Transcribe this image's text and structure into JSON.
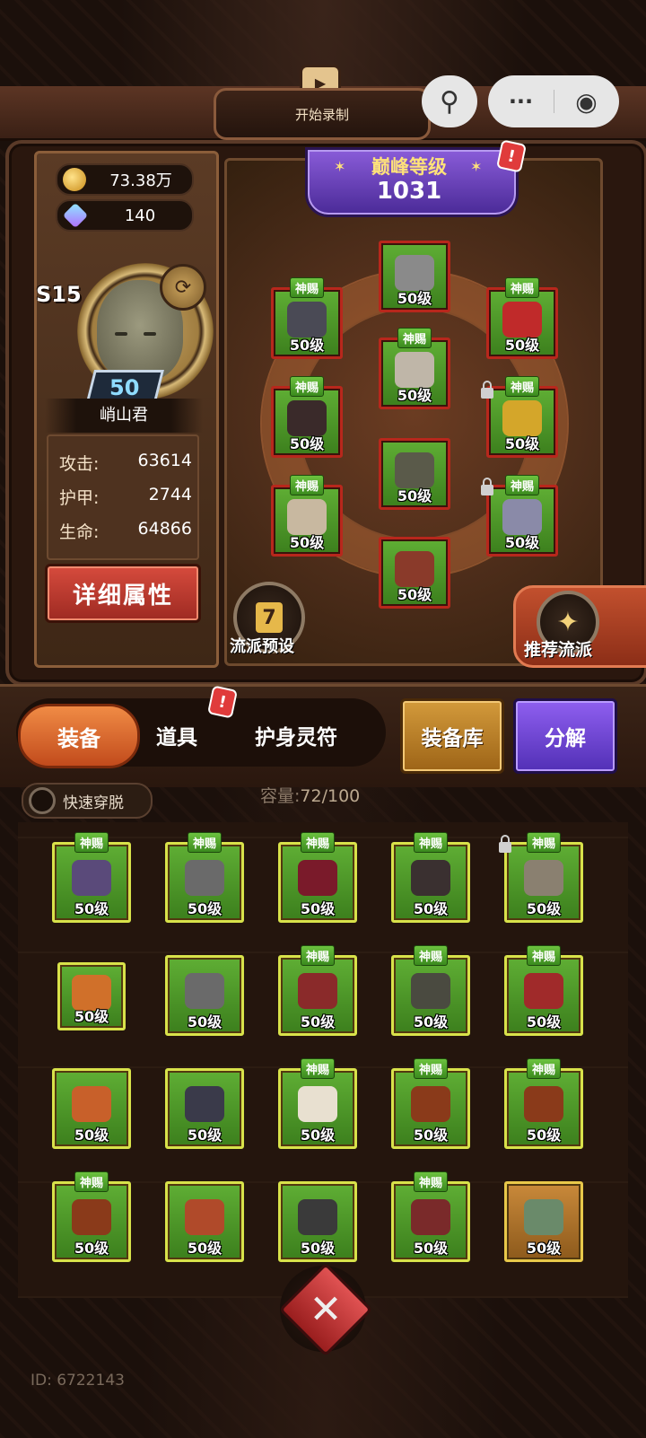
{
  "topbar": {
    "record_label": "开始录制",
    "menu_dots": "···",
    "record_dot": "◉",
    "avatar_glyph": "⚲"
  },
  "currency": {
    "gold": "73.38万",
    "gems": "140"
  },
  "player": {
    "season": "S15",
    "level": "50",
    "name": "峭山君",
    "stats": [
      {
        "label": "攻击:",
        "value": "63614"
      },
      {
        "label": "护甲:",
        "value": "2744"
      },
      {
        "label": "生命:",
        "value": "64866"
      }
    ],
    "detail_button": "详细属性"
  },
  "peak": {
    "title": "巅峰等级",
    "value": "1031"
  },
  "alert_mark": "!",
  "equipped": [
    {
      "tag": "",
      "level": "50级",
      "color": "#8a8a8a"
    },
    {
      "tag": "神赐",
      "level": "50级",
      "color": "#4a4a55"
    },
    {
      "tag": "神赐",
      "level": "50级",
      "color": "#c02a2a"
    },
    {
      "tag": "神赐",
      "level": "50级",
      "color": "#bfb6a8"
    },
    {
      "tag": "神赐",
      "level": "50级",
      "color": "#3a2a2a"
    },
    {
      "tag": "神赐",
      "level": "50级",
      "color": "#d4a62a"
    },
    {
      "tag": "",
      "level": "50级",
      "color": "#5a5a4a"
    },
    {
      "tag": "神赐",
      "level": "50级",
      "color": "#c8b8a0"
    },
    {
      "tag": "神赐",
      "level": "50级",
      "color": "#8a8aa8"
    },
    {
      "tag": "",
      "level": "50级",
      "color": "#8a3a2a"
    }
  ],
  "preset_label": "流派预设",
  "preset_icon": "7",
  "recommend_label": "推荐流派",
  "tabs": {
    "equipment": "装备",
    "items": "道具",
    "talisman": "护身灵符"
  },
  "actions": {
    "warehouse": "装备库",
    "decompose": "分解"
  },
  "quick_toggle": "快速穿脱",
  "capacity": {
    "label": "容量:",
    "value": "72/100"
  },
  "inventory": [
    {
      "tag": "神赐",
      "level": "50级",
      "color": "#5a4a7a"
    },
    {
      "tag": "神赐",
      "level": "50级",
      "color": "#6a6a6a"
    },
    {
      "tag": "神赐",
      "level": "50级",
      "color": "#7a1a2a"
    },
    {
      "tag": "神赐",
      "level": "50级",
      "color": "#3a3030"
    },
    {
      "tag": "神赐",
      "level": "50级",
      "color": "#8a8070"
    },
    {
      "tag": "",
      "level": "50级",
      "color": "#d0702a"
    },
    {
      "tag": "",
      "level": "50级",
      "color": "#6a6a6a"
    },
    {
      "tag": "神赐",
      "level": "50级",
      "color": "#8a2a2a"
    },
    {
      "tag": "神赐",
      "level": "50级",
      "color": "#4a4a40"
    },
    {
      "tag": "神赐",
      "level": "50级",
      "color": "#a02a2a"
    },
    {
      "tag": "",
      "level": "50级",
      "color": "#c8602a"
    },
    {
      "tag": "",
      "level": "50级",
      "color": "#3a3a4a"
    },
    {
      "tag": "神赐",
      "level": "50级",
      "color": "#e8e0d0"
    },
    {
      "tag": "神赐",
      "level": "50级",
      "color": "#8a3a1a"
    },
    {
      "tag": "神赐",
      "level": "50级",
      "color": "#8a3a1a"
    },
    {
      "tag": "神赐",
      "level": "50级",
      "color": "#8a3a1a"
    },
    {
      "tag": "",
      "level": "50级",
      "color": "#b04a2a"
    },
    {
      "tag": "",
      "level": "50级",
      "color": "#3a3a3a"
    },
    {
      "tag": "神赐",
      "level": "50级",
      "color": "#7a2a2a"
    },
    {
      "tag": "",
      "level": "50级",
      "color": "#6a8a6a"
    }
  ],
  "close_glyph": "✕",
  "user_id": "ID: 6722143"
}
